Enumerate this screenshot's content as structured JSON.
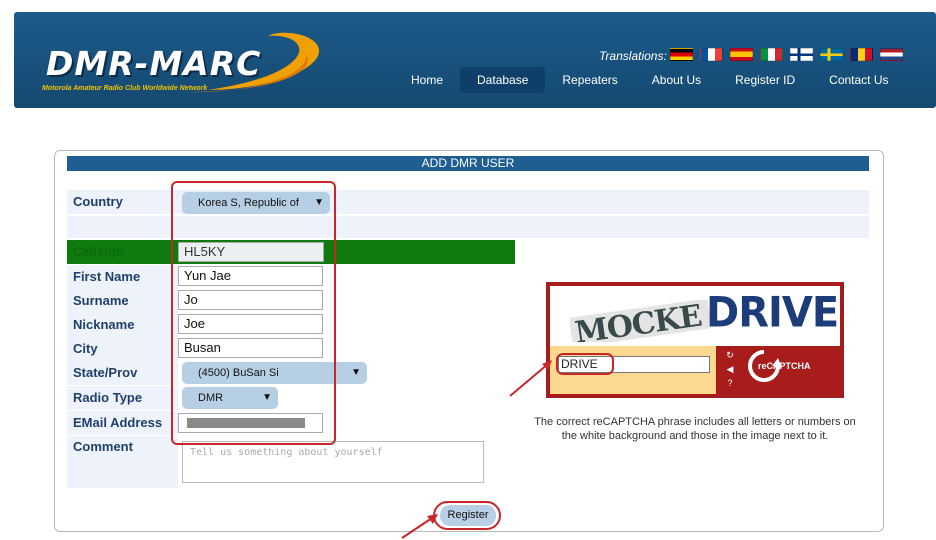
{
  "header": {
    "logo_title": "DMR-MARC",
    "logo_subtitle": "Motorola Amateur Radio Club Worldwide Network",
    "translations_label": "Translations:",
    "flags": [
      "german-flag",
      "french-flag",
      "spanish-flag",
      "italian-flag",
      "finnish-flag",
      "swedish-flag",
      "romanian-flag",
      "dutch-flag"
    ],
    "nav": [
      "Home",
      "Database",
      "Repeaters",
      "About Us",
      "Register ID",
      "Contact Us"
    ],
    "active_nav": "Database"
  },
  "form": {
    "title": "ADD DMR USER",
    "labels": {
      "country": "Country",
      "callsign": "Callsign",
      "first_name": "First Name",
      "surname": "Surname",
      "nickname": "Nickname",
      "city": "City",
      "state": "State/Prov",
      "radio_type": "Radio Type",
      "email": "EMail Address",
      "comment": "Comment"
    },
    "values": {
      "country": "Korea S, Republic of",
      "callsign": "HL5KY",
      "first_name": "Yun Jae",
      "surname": "Jo",
      "nickname": "Joe",
      "city": "Busan",
      "state": "(4500) BuSan Si",
      "radio_type": "DMR",
      "email": ""
    },
    "comment_placeholder": "Tell us something about yourself",
    "register_label": "Register"
  },
  "captcha": {
    "word1": "MOCKE",
    "word2": "DRIVE",
    "input_value": "DRIVE",
    "brand": "reCAPTCHA",
    "note": "The correct reCAPTCHA phrase includes all letters or numbers on the white background and those in the image next to it."
  },
  "colors": {
    "header_bg": "#1c5a8c",
    "form_header": "#1f5e93",
    "callsign_bar": "#0f7b0f",
    "annotation_red": "#c8262a",
    "captcha_bg": "#a81c1c"
  }
}
